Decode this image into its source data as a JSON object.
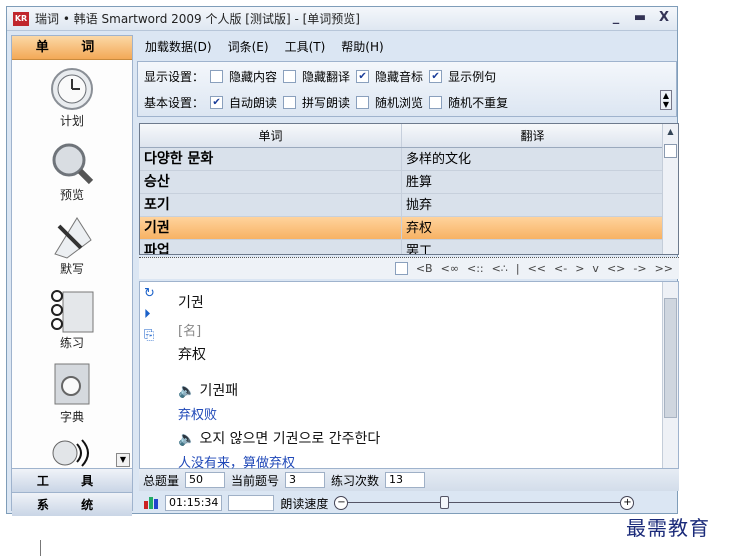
{
  "window": {
    "title": "瑞词 • 韩语 Smartword 2009 个人版 [测试版] - [单词预览]",
    "logo": "KR"
  },
  "controls": {
    "minimize": "_",
    "maximize": "▬",
    "close": "X"
  },
  "sidebar": {
    "header": "单 词",
    "items": [
      {
        "label": "计划",
        "icon": "clock-icon"
      },
      {
        "label": "预览",
        "icon": "magnifier-icon"
      },
      {
        "label": "默写",
        "icon": "pen-icon"
      },
      {
        "label": "练习",
        "icon": "exercise-icon"
      },
      {
        "label": "字典",
        "icon": "dictionary-icon"
      },
      {
        "label": "",
        "icon": "speaker-icon"
      }
    ],
    "footer_tools": "工 具",
    "footer_system": "系 统"
  },
  "menu": [
    "加载数据(D)",
    "词条(E)",
    "工具(T)",
    "帮助(H)"
  ],
  "settings": {
    "display_label": "显示设置：",
    "display_options": [
      {
        "label": "隐藏内容",
        "checked": false
      },
      {
        "label": "隐藏翻译",
        "checked": false
      },
      {
        "label": "隐藏音标",
        "checked": true
      },
      {
        "label": "显示例句",
        "checked": true
      }
    ],
    "basic_label": "基本设置：",
    "basic_options": [
      {
        "label": "自动朗读",
        "checked": true
      },
      {
        "label": "拼写朗读",
        "checked": false
      },
      {
        "label": "随机浏览",
        "checked": false
      },
      {
        "label": "随机不重复",
        "checked": false
      }
    ]
  },
  "table": {
    "headers": [
      "单词",
      "翻译"
    ],
    "rows": [
      {
        "word": "다양한 문화",
        "translation": "多样的文化"
      },
      {
        "word": "승산",
        "translation": "胜算"
      },
      {
        "word": "포기",
        "translation": "抛弃"
      },
      {
        "word": "기권",
        "translation": "弃权",
        "selected": true
      },
      {
        "word": "파업",
        "translation": "罢工"
      }
    ]
  },
  "nav": [
    "<B",
    "<∞",
    "<::",
    "<∴",
    "|",
    "<<",
    "<-",
    ">",
    "v",
    "<>",
    "->",
    ">>"
  ],
  "detail": {
    "word": "기권",
    "pos": "[名]",
    "meaning": "弃权",
    "examples": [
      {
        "ko": "기권패",
        "zh": "弃权败"
      },
      {
        "ko": "오지 않으면 기권으로 간주한다",
        "zh": "人没有来，算做弃权"
      }
    ]
  },
  "status": {
    "total_label": "总题量",
    "total_value": "50",
    "current_label": "当前题号",
    "current_value": "3",
    "practice_label": "练习次数",
    "practice_value": "13"
  },
  "bottom": {
    "time": "01:15:34",
    "speed_label": "朗读速度",
    "speed_value": 0.35
  },
  "watermark": "最需教育",
  "colors": {
    "selected_row": "#f7b264",
    "sidebar_header": "#f3a957",
    "accent_blue": "#1f48b8"
  }
}
